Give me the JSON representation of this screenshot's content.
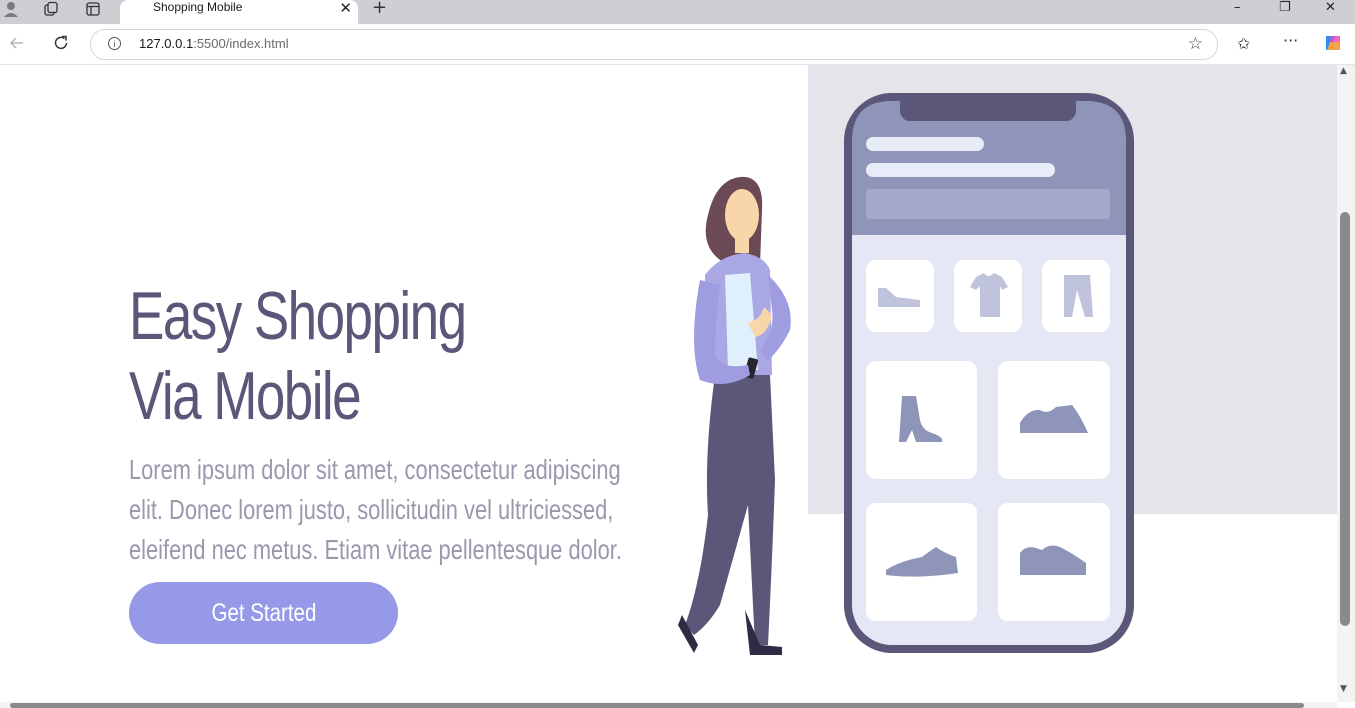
{
  "browser": {
    "tab_title": "Shopping Mobile",
    "tab_close": "✕",
    "new_tab": "+",
    "address_host": "127.0.0.1",
    "address_rest": ":5500/index.html",
    "window_controls": {
      "minimize": "–",
      "restore": "❐",
      "close": "✕"
    }
  },
  "hero": {
    "headline_line1": "Easy Shopping",
    "headline_line2": "Via Mobile",
    "description": "Lorem ipsum dolor sit amet, consectetur adipiscing elit. Donec lorem justo, sollicitudin vel ultriciessed, eleifend nec metus. Etiam vitae pellentesque dolor.",
    "cta_label": "Get Started"
  },
  "colors": {
    "headline": "#5a5779",
    "body_text": "#9a98ad",
    "cta_bg": "#9599e8",
    "phone_frame": "#5a5779",
    "phone_screen": "#e5e7f5",
    "phone_header": "#8e95b8",
    "panel_bg": "#e4e4ea"
  },
  "icons": {
    "tab_favicon": "profile-icon",
    "product_icons": [
      "shoe-icon",
      "tshirt-icon",
      "pants-icon",
      "boot-icon",
      "sneaker-icon",
      "flat-shoe-icon",
      "slip-on-icon"
    ]
  }
}
